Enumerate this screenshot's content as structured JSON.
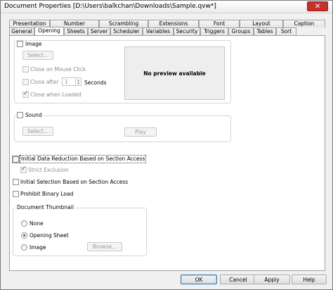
{
  "window": {
    "title": "Document Properties [D:\\Users\\balkchan\\Downloads\\Sample.qvw*]",
    "close_glyph": "✕"
  },
  "tabs": {
    "row1": [
      "Presentation",
      "Number",
      "Scrambling",
      "Extensions",
      "Font",
      "Layout",
      "Caption"
    ],
    "row2": [
      "General",
      "Opening",
      "Sheets",
      "Server",
      "Scheduler",
      "Variables",
      "Security",
      "Triggers",
      "Groups",
      "Tables",
      "Sort"
    ],
    "active": "Opening"
  },
  "image_group": {
    "checkbox_label": "Image",
    "checked": false,
    "select_button": "Select...",
    "close_on_click_label": "Close on Mouse Click",
    "close_after_label": "Close after",
    "close_after_value": "1",
    "seconds_label": "Seconds",
    "close_when_loaded_label": "Close when Loaded",
    "close_when_loaded_checked": true,
    "preview_text": "No preview available"
  },
  "sound_group": {
    "checkbox_label": "Sound",
    "checked": false,
    "select_button": "Select...",
    "play_button": "Play"
  },
  "options": {
    "initial_data_reduction_label": "Initial Data Reduction Based on Section Access",
    "initial_data_reduction_checked": false,
    "strict_exclusion_label": "Strict Exclusion",
    "strict_exclusion_checked": true,
    "initial_selection_label": "Initial Selection Based on Section Access",
    "initial_selection_checked": false,
    "prohibit_binary_load_label": "Prohibit Binary Load",
    "prohibit_binary_load_checked": false
  },
  "thumbnail": {
    "title": "Document Thumbnail",
    "none_label": "None",
    "opening_sheet_label": "Opening Sheet",
    "image_label": "Image",
    "selected": "Opening Sheet",
    "browse_button": "Browse..."
  },
  "footer": {
    "ok": "OK",
    "cancel": "Cancel",
    "apply": "Apply",
    "help": "Help"
  }
}
